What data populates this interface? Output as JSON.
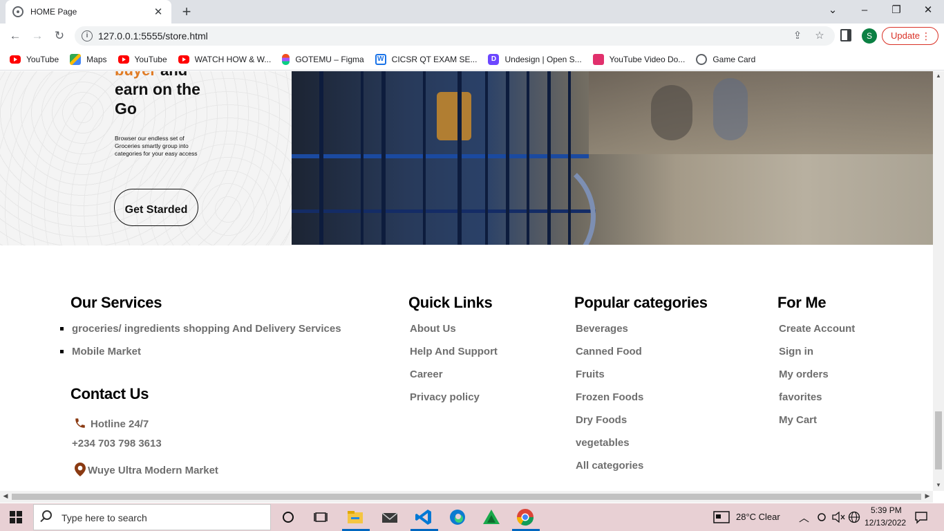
{
  "browser": {
    "tab_title": "HOME Page",
    "url": "127.0.0.1:5555/store.html",
    "profile_initial": "S",
    "update_label": "Update",
    "bookmarks": [
      {
        "label": "YouTube",
        "icon": "youtube-icon"
      },
      {
        "label": "Maps",
        "icon": "maps-icon"
      },
      {
        "label": "YouTube",
        "icon": "youtube-icon"
      },
      {
        "label": "WATCH HOW & W...",
        "icon": "youtube-icon"
      },
      {
        "label": "GOTEMU – Figma",
        "icon": "figma-icon"
      },
      {
        "label": "CICSR QT EXAM SE...",
        "icon": "w-icon"
      },
      {
        "label": "Undesign | Open S...",
        "icon": "undesign-icon"
      },
      {
        "label": "YouTube Video Do...",
        "icon": "download-icon"
      },
      {
        "label": "Game Card",
        "icon": "gamecard-icon"
      }
    ]
  },
  "hero": {
    "accent_word": "buyer",
    "accent_rest": " and",
    "title": "earn on the Go",
    "description": "Browser our endless set of Groceries smartly group into categories for your easy access",
    "cta": "Get Starded",
    "accent_color": "#e07b24"
  },
  "footer": {
    "services": {
      "heading": "Our Services",
      "items": [
        "groceries/ ingredients shopping And Delivery Services",
        "Mobile Market"
      ]
    },
    "contact": {
      "heading": "Contact Us",
      "hotline_label": "Hotline 24/7",
      "phone": "+234 703 798 3613",
      "address": "Wuye Ultra Modern Market"
    },
    "quick_links": {
      "heading": "Quick Links",
      "items": [
        "About Us",
        "Help And Support",
        "Career",
        "Privacy policy"
      ]
    },
    "categories": {
      "heading": "Popular categories",
      "items": [
        "Beverages",
        "Canned Food",
        "Fruits",
        "Frozen Foods",
        "Dry Foods",
        "vegetables",
        "All categories"
      ]
    },
    "for_me": {
      "heading": "For Me",
      "items": [
        "Create Account",
        "Sign in",
        "My orders",
        "favorites",
        "My Cart"
      ]
    }
  },
  "taskbar": {
    "search_placeholder": "Type here to search",
    "weather": "28°C  Clear",
    "time": "5:39 PM",
    "date": "12/13/2022"
  }
}
